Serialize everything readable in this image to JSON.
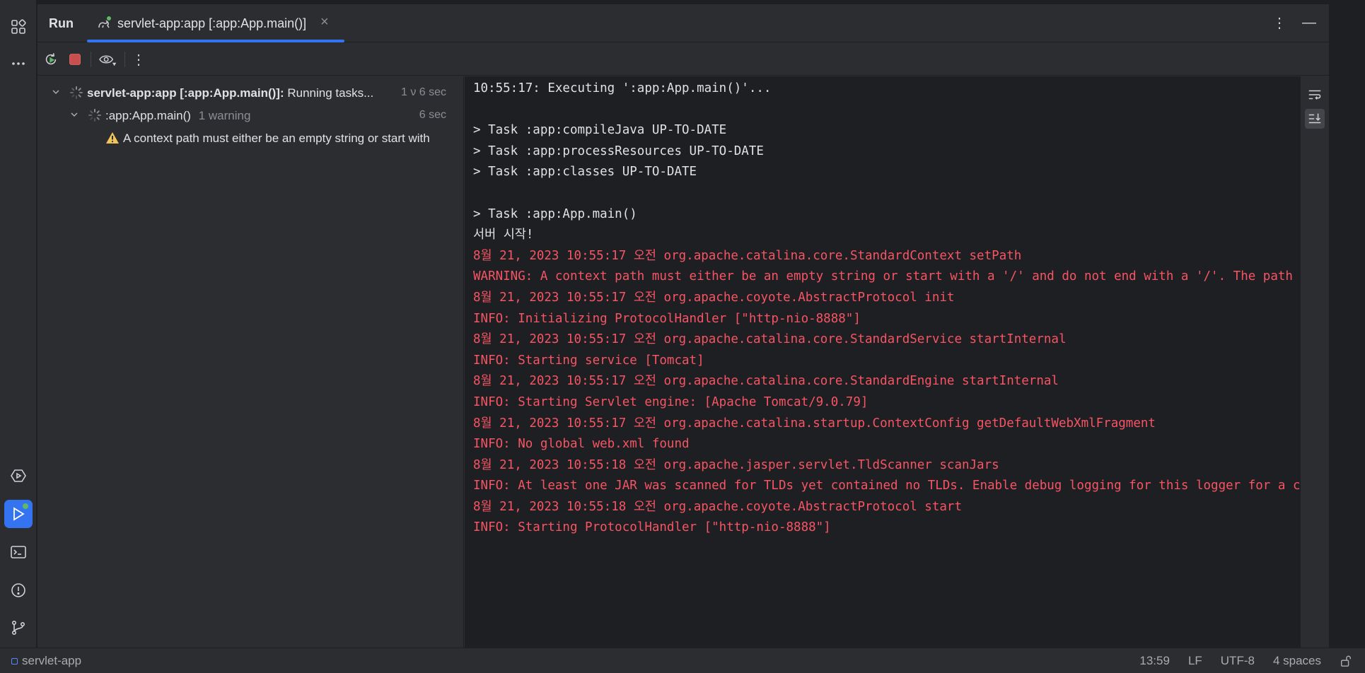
{
  "activity_bar": {
    "top_icons": [
      "project-structure-icon",
      "more-icon"
    ],
    "bottom_icons": [
      "services-icon",
      "run-icon",
      "terminal-icon",
      "problems-icon",
      "git-icon"
    ]
  },
  "tool_window": {
    "title": "Run",
    "tab": {
      "label": "servlet-app:app [:app:App.main()]",
      "close": "×"
    },
    "actions": {
      "more": "⋮",
      "minimize": "—"
    }
  },
  "toolbar": {
    "buttons": [
      "rerun-icon",
      "stop-icon",
      "eye-icon",
      "more-vertical-icon"
    ],
    "more": "⋮"
  },
  "tree": {
    "root": {
      "name": "servlet-app:app [:app:App.main()]:",
      "status": "Running tasks...",
      "time": "1 ν 6 sec"
    },
    "child": {
      "name": ":app:App.main()",
      "warning_count": "1 warning",
      "time": "6 sec"
    },
    "warning": {
      "text": "A context path must either be an empty string or start with"
    }
  },
  "console": {
    "lines": [
      {
        "text": "10:55:17: Executing ':app:App.main()'...",
        "type": "plain"
      },
      {
        "text": "",
        "type": "plain"
      },
      {
        "text": "> Task :app:compileJava UP-TO-DATE",
        "type": "plain"
      },
      {
        "text": "> Task :app:processResources UP-TO-DATE",
        "type": "plain"
      },
      {
        "text": "> Task :app:classes UP-TO-DATE",
        "type": "plain"
      },
      {
        "text": "",
        "type": "plain"
      },
      {
        "text": "> Task :app:App.main()",
        "type": "plain"
      },
      {
        "text": "서버 시작!",
        "type": "plain"
      },
      {
        "text": "8월 21, 2023 10:55:17 오전 org.apache.catalina.core.StandardContext setPath",
        "type": "err"
      },
      {
        "text": "WARNING: A context path must either be an empty string or start with a '/' and do not end with a '/'. The path [/] does not meet these criteria",
        "type": "err"
      },
      {
        "text": "8월 21, 2023 10:55:17 오전 org.apache.coyote.AbstractProtocol init",
        "type": "err"
      },
      {
        "text": "INFO: Initializing ProtocolHandler [\"http-nio-8888\"]",
        "type": "err"
      },
      {
        "text": "8월 21, 2023 10:55:17 오전 org.apache.catalina.core.StandardService startInternal",
        "type": "err"
      },
      {
        "text": "INFO: Starting service [Tomcat]",
        "type": "err"
      },
      {
        "text": "8월 21, 2023 10:55:17 오전 org.apache.catalina.core.StandardEngine startInternal",
        "type": "err"
      },
      {
        "text": "INFO: Starting Servlet engine: [Apache Tomcat/9.0.79]",
        "type": "err"
      },
      {
        "text": "8월 21, 2023 10:55:17 오전 org.apache.catalina.startup.ContextConfig getDefaultWebXmlFragment",
        "type": "err"
      },
      {
        "text": "INFO: No global web.xml found",
        "type": "err"
      },
      {
        "text": "8월 21, 2023 10:55:18 오전 org.apache.jasper.servlet.TldScanner scanJars",
        "type": "err"
      },
      {
        "text": "INFO: At least one JAR was scanned for TLDs yet contained no TLDs. Enable debug logging for this logger for a complete list of JARs",
        "type": "err"
      },
      {
        "text": "8월 21, 2023 10:55:18 오전 org.apache.coyote.AbstractProtocol start",
        "type": "err"
      },
      {
        "text": "INFO: Starting ProtocolHandler [\"http-nio-8888\"]",
        "type": "err"
      }
    ]
  },
  "status_bar": {
    "project": "servlet-app",
    "position": "13:59",
    "line_separator": "LF",
    "encoding": "UTF-8",
    "indent": "4 spaces"
  },
  "colors": {
    "accent": "#3574f0",
    "error_text": "#f75464",
    "success_dot": "#5fb865",
    "warning": "#f2c55c"
  }
}
